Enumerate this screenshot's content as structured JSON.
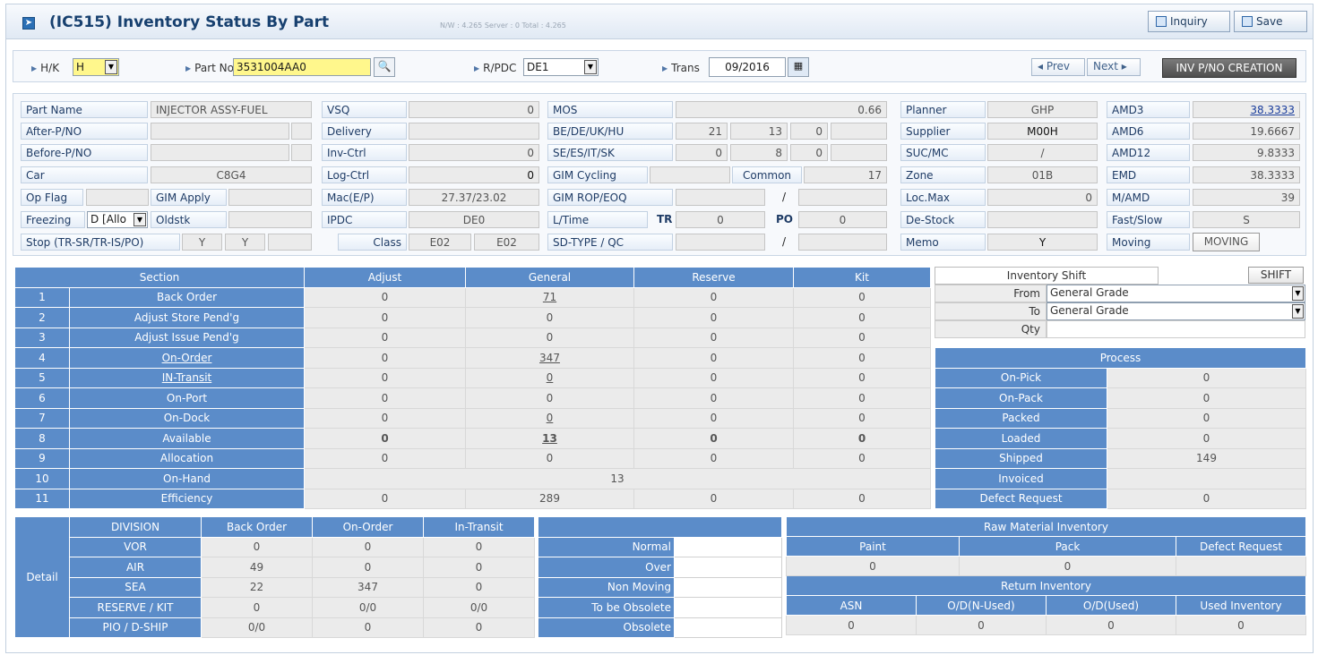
{
  "header": {
    "title": "(IC515) Inventory Status By Part",
    "server_info": "N/W : 4.265   Server : 0   Total : 4.265",
    "inquiry_label": "Inquiry",
    "save_label": "Save"
  },
  "search": {
    "hk_label": "H/K",
    "hk_value": "H",
    "partno_label": "Part No",
    "partno_value": "3531004AA0",
    "rpdc_label": "R/PDC",
    "rpdc_value": "DE1",
    "trans_label": "Trans",
    "trans_value": "09/2016",
    "prev_label": "◂ Prev",
    "next_label": "Next ▸",
    "inv_creation_label": "INV P/NO CREATION"
  },
  "info": {
    "part_name_label": "Part Name",
    "part_name": "INJECTOR ASSY-FUEL",
    "after_pno_label": "After-P/NO",
    "before_pno_label": "Before-P/NO",
    "car_label": "Car",
    "car": "C8G4",
    "op_flag_label": "Op Flag",
    "gim_apply_label": "GIM Apply",
    "freezing_label": "Freezing",
    "freezing_value": "D [Allo",
    "oldstk_label": "Oldstk",
    "stop_label": "Stop (TR-SR/TR-IS/PO)",
    "stop_v1": "Y",
    "stop_v2": "Y",
    "vsq_label": "VSQ",
    "vsq": "0",
    "delivery_label": "Delivery",
    "inv_ctrl_label": "Inv-Ctrl",
    "inv_ctrl": "0",
    "log_ctrl_label": "Log-Ctrl",
    "log_ctrl": "0",
    "mac_label": "Mac(E/P)",
    "mac": "27.37/23.02",
    "ipdc_label": "IPDC",
    "ipdc": "DE0",
    "class_label": "Class",
    "class_v1": "E02",
    "class_v2": "E02",
    "mos_label": "MOS",
    "mos": "0.66",
    "be_label": "BE/DE/UK/HU",
    "be1": "21",
    "be2": "13",
    "be3": "0",
    "se_label": "SE/ES/IT/SK",
    "se1": "0",
    "se2": "8",
    "se3": "0",
    "gim_cycling_label": "GIM Cycling",
    "common_label": "Common",
    "common": "17",
    "gim_rop_label": "GIM ROP/EOQ",
    "slash": "/",
    "ltime_label": "L/Time",
    "tr_label": "TR",
    "tr": "0",
    "po_label": "PO",
    "po": "0",
    "sdtype_label": "SD-TYPE / QC",
    "planner_label": "Planner",
    "planner": "GHP",
    "supplier_label": "Supplier",
    "supplier": "M00H",
    "sucmc_label": "SUC/MC",
    "sucmc": "/",
    "zone_label": "Zone",
    "zone": "01B",
    "locmax_label": "Loc.Max",
    "locmax": "0",
    "destock_label": "De-Stock",
    "memo_label": "Memo",
    "memo": "Y",
    "amd3_label": "AMD3",
    "amd3": "38.3333",
    "amd6_label": "AMD6",
    "amd6": "19.6667",
    "amd12_label": "AMD12",
    "amd12": "9.8333",
    "emd_label": "EMD",
    "emd": "38.3333",
    "mamd_label": "M/AMD",
    "mamd": "39",
    "fastslow_label": "Fast/Slow",
    "fastslow": "S",
    "moving_label": "Moving",
    "moving": "MOVING"
  },
  "section": {
    "headers": [
      "Section",
      "Adjust",
      "General",
      "Reserve",
      "Kit"
    ],
    "rows": [
      {
        "n": "1",
        "name": "Back Order",
        "adjust": "0",
        "general": "71",
        "reserve": "0",
        "kit": "0"
      },
      {
        "n": "2",
        "name": "Adjust Store Pend'g",
        "adjust": "0",
        "general": "0",
        "reserve": "0",
        "kit": "0"
      },
      {
        "n": "3",
        "name": "Adjust Issue Pend'g",
        "adjust": "0",
        "general": "0",
        "reserve": "0",
        "kit": "0"
      },
      {
        "n": "4",
        "name": "On-Order",
        "adjust": "0",
        "general": "347",
        "reserve": "0",
        "kit": "0"
      },
      {
        "n": "5",
        "name": "IN-Transit",
        "adjust": "0",
        "general": "0",
        "reserve": "0",
        "kit": "0"
      },
      {
        "n": "6",
        "name": "On-Port",
        "adjust": "0",
        "general": "0",
        "reserve": "0",
        "kit": "0"
      },
      {
        "n": "7",
        "name": "On-Dock",
        "adjust": "0",
        "general": "0",
        "reserve": "0",
        "kit": "0"
      },
      {
        "n": "8",
        "name": "Available",
        "adjust": "0",
        "general": "13",
        "reserve": "0",
        "kit": "0"
      },
      {
        "n": "9",
        "name": "Allocation",
        "adjust": "0",
        "general": "0",
        "reserve": "0",
        "kit": "0"
      },
      {
        "n": "10",
        "name": "On-Hand",
        "onhand": "13"
      },
      {
        "n": "11",
        "name": "Efficiency",
        "adjust": "0",
        "general": "289",
        "reserve": "0",
        "kit": "0"
      }
    ]
  },
  "shift": {
    "title": "Inventory Shift",
    "button": "SHIFT",
    "from_label": "From",
    "from_value": "General Grade",
    "to_label": "To",
    "to_value": "General Grade",
    "qty_label": "Qty"
  },
  "process": {
    "title": "Process",
    "rows": [
      {
        "label": "On-Pick",
        "value": "0"
      },
      {
        "label": "On-Pack",
        "value": "0"
      },
      {
        "label": "Packed",
        "value": "0"
      },
      {
        "label": "Loaded",
        "value": "0"
      },
      {
        "label": "Shipped",
        "value": "149"
      },
      {
        "label": "Invoiced",
        "value": ""
      },
      {
        "label": "Defect Request",
        "value": "0"
      }
    ]
  },
  "detail": {
    "label": "Detail",
    "headers": [
      "DIVISION",
      "Back Order",
      "On-Order",
      "In-Transit"
    ],
    "rows": [
      [
        "VOR",
        "0",
        "0",
        "0"
      ],
      [
        "AIR",
        "49",
        "0",
        "0"
      ],
      [
        "SEA",
        "22",
        "347",
        "0"
      ],
      [
        "RESERVE / KIT",
        "0",
        "0/0",
        "0/0"
      ],
      [
        "PIO / D-SHIP",
        "0/0",
        "0",
        "0"
      ]
    ]
  },
  "status": {
    "rows": [
      "Normal",
      "Over",
      "Non Moving",
      "To be Obsolete",
      "Obsolete"
    ]
  },
  "raw": {
    "title": "Raw Material Inventory",
    "headers": [
      "Paint",
      "Pack",
      "Defect Request"
    ],
    "values": [
      "0",
      "0",
      ""
    ],
    "return_title": "Return Inventory",
    "return_headers": [
      "ASN",
      "O/D(N-Used)",
      "O/D(Used)",
      "Used Inventory"
    ],
    "return_values": [
      "0",
      "0",
      "0",
      "0"
    ]
  }
}
